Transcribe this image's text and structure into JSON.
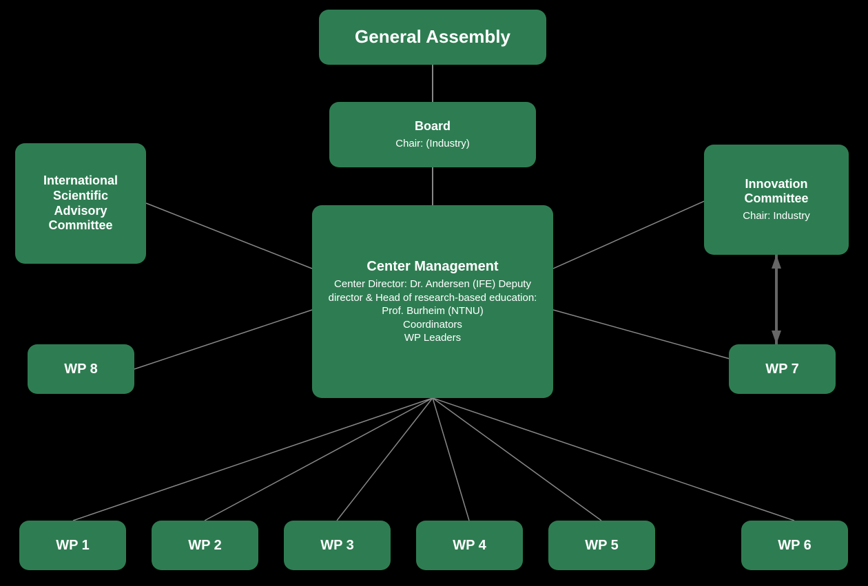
{
  "nodes": {
    "general_assembly": {
      "id": "node-ga",
      "title": "General Assembly"
    },
    "board": {
      "id": "node-board",
      "title": "Board",
      "subtitle": "Chair: (Industry)"
    },
    "center_management": {
      "id": "node-cm",
      "title": "Center Management",
      "subtitle": "Center Director: Dr. Andersen (IFE) Deputy director & Head of research-based education: Prof. Burheim (NTNU) Coordinators WP Leaders"
    },
    "isac": {
      "id": "node-isac",
      "title": "International Scientific Advisory Committee"
    },
    "innovation_committee": {
      "id": "node-ic",
      "title": "Innovation Committee",
      "subtitle": "Chair: Industry"
    },
    "wp8": {
      "id": "node-wp8",
      "title": "WP 8"
    },
    "wp7": {
      "id": "node-wp7",
      "title": "WP 7"
    },
    "wp1": {
      "id": "node-wp1",
      "title": "WP 1"
    },
    "wp2": {
      "id": "node-wp2",
      "title": "WP 2"
    },
    "wp3": {
      "id": "node-wp3",
      "title": "WP 3"
    },
    "wp4": {
      "id": "node-wp4",
      "title": "WP 4"
    },
    "wp5": {
      "id": "node-wp5",
      "title": "WP 5"
    },
    "wp6": {
      "id": "node-wp6",
      "title": "WP 6"
    }
  },
  "colors": {
    "bg": "#000000",
    "node": "#2e7d52",
    "line": "#888888",
    "arrow": "#666666"
  }
}
